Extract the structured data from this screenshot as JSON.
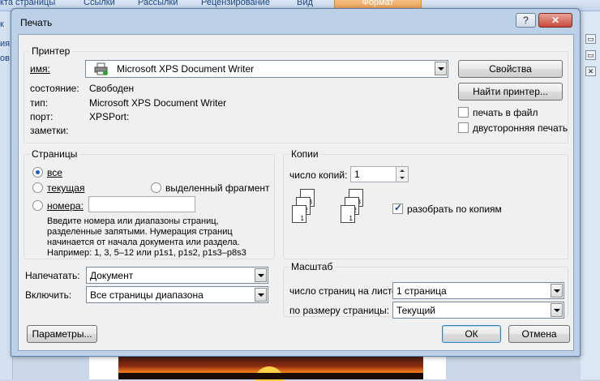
{
  "background": {
    "ribbon_tabs": [
      "кта страницы",
      "Ссылки",
      "Рассылки",
      "Рецензирование",
      "Вид",
      "Формат"
    ],
    "left_labels": [
      "к",
      "ия",
      "ов"
    ]
  },
  "dialog": {
    "title": "Печать",
    "help_label": "?",
    "close_label": "✕",
    "printer": {
      "legend": "Принтер",
      "name_label": "имя:",
      "name_value": "Microsoft XPS Document Writer",
      "status_label": "состояние:",
      "status_value": "Свободен",
      "type_label": "тип:",
      "type_value": "Microsoft XPS Document Writer",
      "port_label": "порт:",
      "port_value": "XPSPort:",
      "notes_label": "заметки:",
      "properties_button": "Свойства",
      "find_button": "Найти принтер...",
      "print_to_file": "печать в файл",
      "duplex": "двусторонняя печать"
    },
    "pages": {
      "legend": "Страницы",
      "all": "все",
      "current": "текущая",
      "selection": "выделенный фрагмент",
      "numbers": "номера:",
      "hint_lines": [
        "Введите номера или диапазоны страниц,",
        "разделенные запятыми. Нумерация страниц",
        "начинается от начала документа или раздела.",
        "Например: 1, 3, 5–12 или p1s1, p1s2, p1s3–p8s3"
      ]
    },
    "copies": {
      "legend": "Копии",
      "count_label": "число копий:",
      "count_value": "1",
      "collate": "разобрать по копиям",
      "page_numbers": [
        "1",
        "2",
        "3"
      ]
    },
    "print_what_label": "Напечатать:",
    "print_what_value": "Документ",
    "include_label": "Включить:",
    "include_value": "Все страницы диапазона",
    "zoom": {
      "legend": "Масштаб",
      "pages_per_sheet_label": "число страниц на листе:",
      "pages_per_sheet_value": "1 страница",
      "scale_label": "по размеру страницы:",
      "scale_value": "Текущий"
    },
    "options_button": "Параметры...",
    "ok_button": "ОК",
    "cancel_button": "Отмена"
  }
}
